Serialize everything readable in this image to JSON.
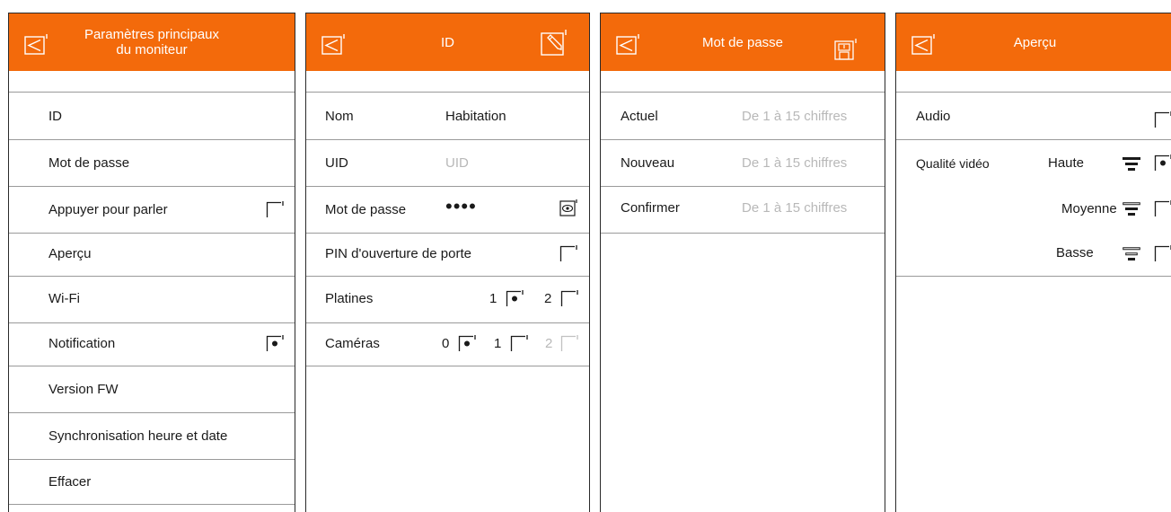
{
  "screen1": {
    "title_line1": "Paramètres principaux",
    "title_line2": "du moniteur",
    "items": [
      {
        "label": "ID"
      },
      {
        "label": "Mot de passe"
      },
      {
        "label": "Appuyer pour parler",
        "checkbox": "unchecked"
      },
      {
        "label": "Aperçu"
      },
      {
        "label": "Wi-Fi"
      },
      {
        "label": "Notification",
        "checkbox": "checked"
      },
      {
        "label": "Version FW"
      },
      {
        "label": "Synchronisation heure et date"
      },
      {
        "label": "Effacer"
      }
    ]
  },
  "screen2": {
    "title": "ID",
    "name_label": "Nom",
    "name_value": "Habitation",
    "uid_label": "UID",
    "uid_value": "UID",
    "password_label": "Mot de passe",
    "password_value": "••••",
    "pin_label": "PIN d'ouverture de porte",
    "pin_checkbox": "unchecked",
    "platines_label": "Platines",
    "platines_options": [
      "1",
      "2"
    ],
    "platines_selected": "1",
    "cameras_label": "Caméras",
    "cameras_options": [
      "0",
      "1",
      "2"
    ],
    "cameras_selected": "0",
    "cameras_disabled": "2"
  },
  "screen3": {
    "title": "Mot de passe",
    "rows": [
      {
        "label": "Actuel",
        "placeholder": "De 1 à 15 chiffres"
      },
      {
        "label": "Nouveau",
        "placeholder": "De 1 à 15 chiffres"
      },
      {
        "label": "Confirmer",
        "placeholder": "De 1 à 15 chiffres"
      }
    ]
  },
  "screen4": {
    "title": "Aperçu",
    "audio_label": "Audio",
    "audio_checkbox": "unchecked",
    "video_quality_label": "Qualité vidéo",
    "quality_options": [
      {
        "label": "Haute",
        "selected": true
      },
      {
        "label": "Moyenne",
        "selected": false
      },
      {
        "label": "Basse",
        "selected": false
      }
    ]
  },
  "colors": {
    "header": "#f36a0b",
    "divider": "#9a9a9a",
    "placeholder": "#b8b8b8"
  },
  "icons": [
    "back-icon",
    "edit-icon",
    "save-icon",
    "eye-icon",
    "quality-high-icon",
    "quality-medium-icon",
    "quality-low-icon"
  ]
}
